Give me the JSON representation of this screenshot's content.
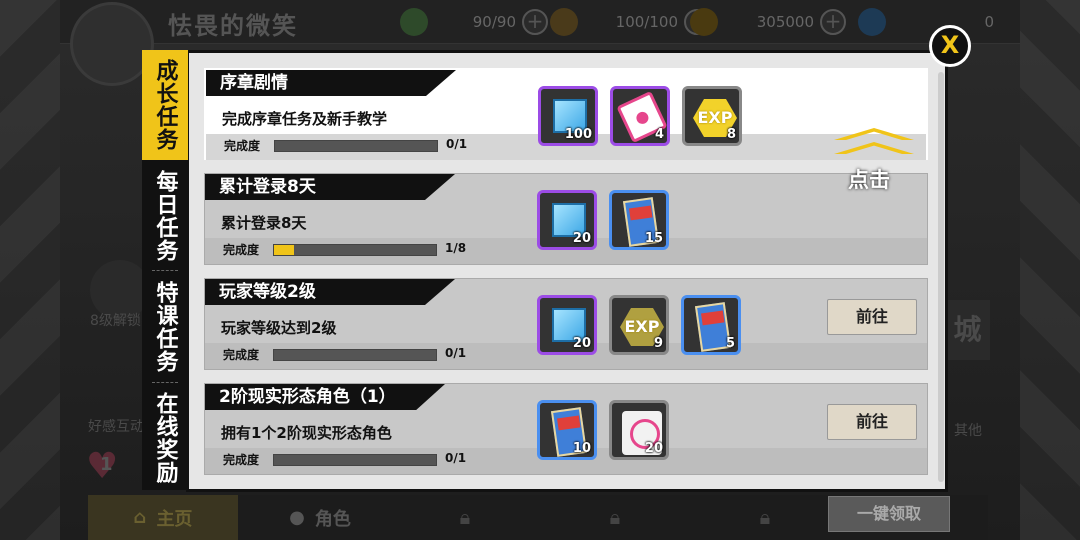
{
  "topbar": {
    "player_name": "怯畏的微笑",
    "stamina": "90/90",
    "energy": "100/100",
    "gold": "305000",
    "gems": "0"
  },
  "bottom_nav": {
    "home_label": "主页",
    "role_label": "角色"
  },
  "left_side": {
    "unlock_hint": "8级解锁",
    "affinity_label": "好感互动",
    "heart_value": "1"
  },
  "right_side": {
    "city_label": "城",
    "other_label": "其他"
  },
  "side_tabs": [
    {
      "label": "成长任务",
      "active": true
    },
    {
      "label": "每日任务",
      "active": false
    },
    {
      "label": "特课任务",
      "active": false
    },
    {
      "label": "在线奖励",
      "active": false
    }
  ],
  "close_icon": "X",
  "hint": {
    "label": "点击"
  },
  "claim_all_label": "一键领取",
  "tasks": [
    {
      "title": "序章剧情",
      "desc": "完成序章任务及新手教学",
      "progress_label": "完成度",
      "progress_text": "0/1",
      "progress": 0,
      "rewards": [
        {
          "icon": "blue-cube-icon",
          "qty": "100"
        },
        {
          "icon": "pink-ticket-icon",
          "qty": "4"
        },
        {
          "icon": "exp-icon",
          "qty": "8"
        }
      ],
      "go_label": ""
    },
    {
      "title": "累计登录8天",
      "desc": "累计登录8天",
      "progress_label": "完成度",
      "progress_text": "1/8",
      "progress": 0.125,
      "rewards": [
        {
          "icon": "blue-cube-icon",
          "qty": "20"
        },
        {
          "icon": "card-pack-icon",
          "qty": "15"
        }
      ],
      "go_label": ""
    },
    {
      "title": "玩家等级2级",
      "desc": "玩家等级达到2级",
      "progress_label": "完成度",
      "progress_text": "0/1",
      "progress": 0,
      "rewards": [
        {
          "icon": "blue-cube-icon",
          "qty": "20"
        },
        {
          "icon": "exp-icon",
          "qty": "9"
        },
        {
          "icon": "card-pack-icon",
          "qty": "5"
        }
      ],
      "go_label": "前往"
    },
    {
      "title": "2阶现实形态角色（1）",
      "desc": "拥有1个2阶现实形态角色",
      "progress_label": "完成度",
      "progress_text": "0/1",
      "progress": 0,
      "rewards": [
        {
          "icon": "card-pack-icon",
          "qty": "10"
        },
        {
          "icon": "robot-ticket-icon",
          "qty": "20"
        }
      ],
      "go_label": "前往"
    }
  ]
}
